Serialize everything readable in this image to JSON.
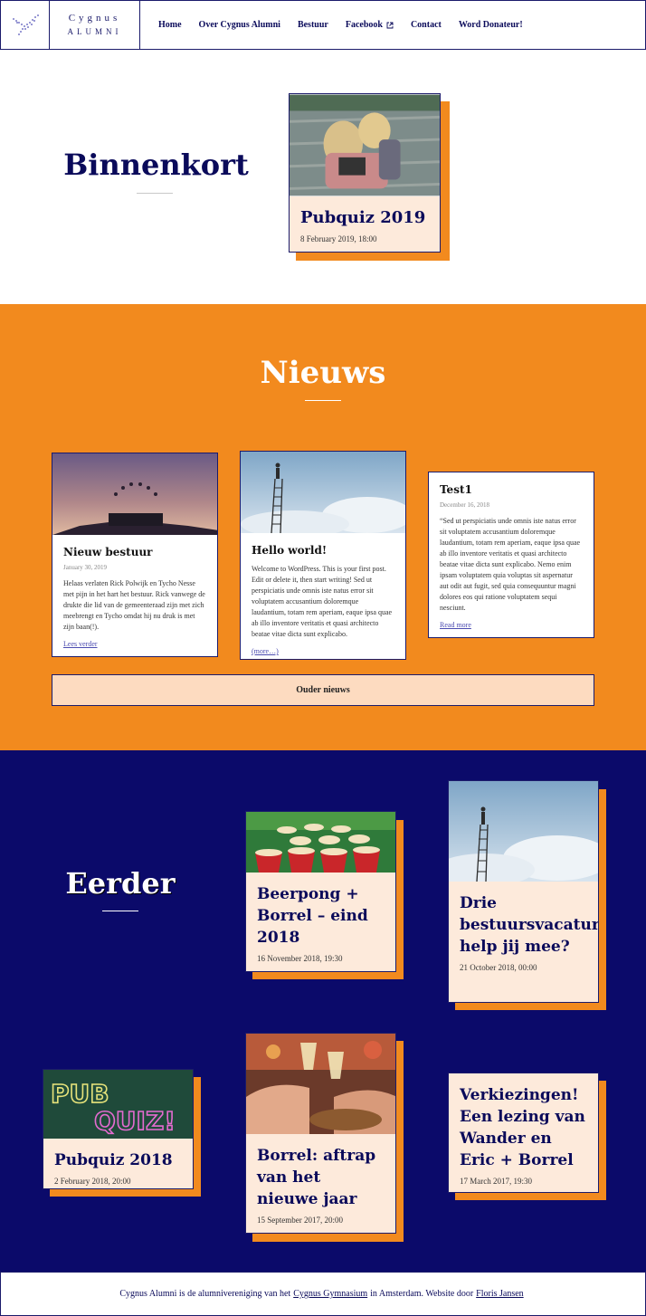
{
  "header": {
    "logo_line1": "Cygnus",
    "logo_line2": "alumni",
    "nav": [
      {
        "label": "Home"
      },
      {
        "label": "Over Cygnus Alumni"
      },
      {
        "label": "Bestuur"
      },
      {
        "label": "Facebook"
      },
      {
        "label": "Contact"
      },
      {
        "label": "Word Donateur!"
      }
    ]
  },
  "upcoming": {
    "heading": "Binnenkort",
    "event": {
      "title": "Pubquiz 2019",
      "date": "8 February 2019, 18:00"
    }
  },
  "news": {
    "heading": "Nieuws",
    "items": [
      {
        "title": "Nieuw bestuur",
        "date": "January 30, 2019",
        "text": "Helaas verlaten Rick Polwijk en Tycho Nesse met pijn in het hart het bestuur. Rick vanwege de drukte die lid van de gemeenteraad zijn met zich meebrengt en Tycho omdat hij nu druk is met zijn baan(!).",
        "link": "Lees verder"
      },
      {
        "title": "Hello world!",
        "text": "Welcome to WordPress. This is your first post. Edit or delete it, then start writing! Sed ut perspiciatis unde omnis iste natus error sit voluptatem accusantium doloremque laudantium, totam rem aperiam, eaque ipsa quae ab illo inventore veritatis et quasi architecto beatae vitae dicta sunt explicabo.",
        "link": "(more…)"
      },
      {
        "title": "Test1",
        "date": "December 16, 2018",
        "text": "“Sed ut perspiciatis unde omnis iste natus error sit voluptatem accusantium doloremque laudantium, totam rem aperiam, eaque ipsa quae ab illo inventore veritatis et quasi architecto beatae vitae dicta sunt explicabo. Nemo enim ipsam voluptatem quia voluptas sit aspernatur aut odit aut fugit, sed quia consequuntur magni dolores eos qui ratione voluptatem sequi nesciunt.",
        "link": "Read more"
      }
    ],
    "older_button": "Ouder nieuws"
  },
  "past": {
    "heading": "Eerder",
    "events": [
      {
        "title": "Beerpong + Borrel – eind 2018",
        "date": "16 November 2018, 19:30"
      },
      {
        "title": "Drie bestuursvacatures: help jij mee?",
        "date": "21 October 2018, 00:00"
      },
      {
        "title": "Pubquiz 2018",
        "date": "2 February 2018, 20:00"
      },
      {
        "title": "Borrel: aftrap van het nieuwe jaar",
        "date": "15 September 2017, 20:00"
      },
      {
        "title": "Verkiezingen! Een lezing van Wander en Eric + Borrel",
        "date": "17 March 2017, 19:30"
      }
    ]
  },
  "footer": {
    "text1": "Cygnus Alumni is de alumnivereniging van het",
    "link1": "Cygnus Gymnasium",
    "text2": "in Amsterdam. Website door",
    "link2": "Floris Jansen"
  },
  "colors": {
    "navy": "#0b0a6a",
    "orange": "#f28a1e",
    "peach": "#fdeadb"
  }
}
